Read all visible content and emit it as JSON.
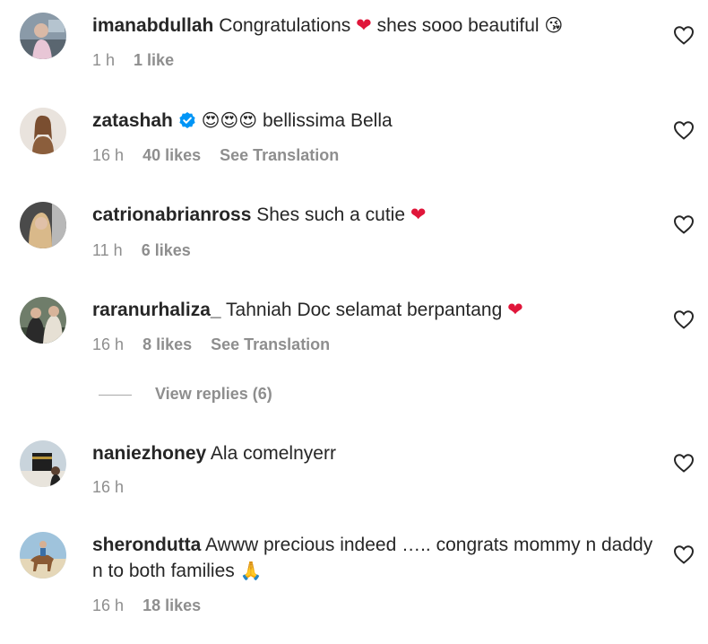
{
  "comments": [
    {
      "username": "imanabdullah",
      "text": "Congratulations",
      "emoji_a": "❤",
      "text_b": "shes sooo beautiful",
      "emoji_b": "😘",
      "time": "1 h",
      "likes": "1 like",
      "translation": ""
    },
    {
      "username": "zatashah",
      "verified": true,
      "emoji_a": "😍😍😍",
      "text": "bellissima Bella",
      "time": "16 h",
      "likes": "40 likes",
      "translation": "See Translation"
    },
    {
      "username": "catrionabrianross",
      "text": "Shes such a cutie",
      "emoji_a": "❤",
      "time": "11 h",
      "likes": "6 likes",
      "translation": ""
    },
    {
      "username": "raranurhaliza_",
      "text": "Tahniah Doc selamat berpantang",
      "emoji_a": "❤",
      "time": "16 h",
      "likes": "8 likes",
      "translation": "See Translation",
      "view_replies": "View replies (6)"
    },
    {
      "username": "naniezhoney",
      "text": "Ala comelnyerr",
      "time": "16 h",
      "likes": "",
      "translation": ""
    },
    {
      "username": "sherondutta",
      "text": "Awww precious indeed ….. congrats mommy n daddy n to both families",
      "emoji_a": "🙏",
      "time": "16 h",
      "likes": "18 likes",
      "translation": ""
    }
  ],
  "colors": {
    "primary_text": "#262626",
    "secondary_text": "#8e8e8e",
    "heart": "#e0163a",
    "verified": "#0095f6"
  },
  "icons": {
    "like": "heart-outline-icon",
    "verified": "verified-badge-icon"
  }
}
